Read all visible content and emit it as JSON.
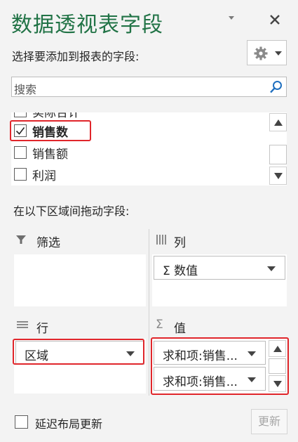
{
  "header": {
    "title": "数据透视表字段",
    "chevron_icon": "chevron-down-icon",
    "close_icon": "close-icon"
  },
  "field_picker": {
    "subtitle": "选择要添加到报表的字段:",
    "gear_icon": "gear-icon",
    "search_placeholder": "搜索",
    "search_icon": "search-icon",
    "fields": [
      {
        "label": "实际合计",
        "checked": false,
        "bold": false
      },
      {
        "label": "销售数",
        "checked": true,
        "bold": true
      },
      {
        "label": "销售额",
        "checked": false,
        "bold": false
      },
      {
        "label": "利润",
        "checked": false,
        "bold": false
      }
    ]
  },
  "areas": {
    "instruction": "在以下区域间拖动字段:",
    "filters": {
      "label": "筛选",
      "icon": "filter-icon",
      "items": []
    },
    "columns": {
      "label": "列",
      "icon": "columns-icon",
      "items": [
        "Σ 数值"
      ]
    },
    "rows": {
      "label": "行",
      "icon": "rows-icon",
      "items": [
        "区域"
      ]
    },
    "values": {
      "label": "值",
      "icon": "sigma-icon",
      "items": [
        "求和项:销售...",
        "求和项:销售..."
      ]
    }
  },
  "footer": {
    "defer_label": "延迟布局更新",
    "defer_checked": false,
    "update_label": "更新"
  },
  "colors": {
    "accent": "#217346",
    "highlight": "#e0262b"
  }
}
